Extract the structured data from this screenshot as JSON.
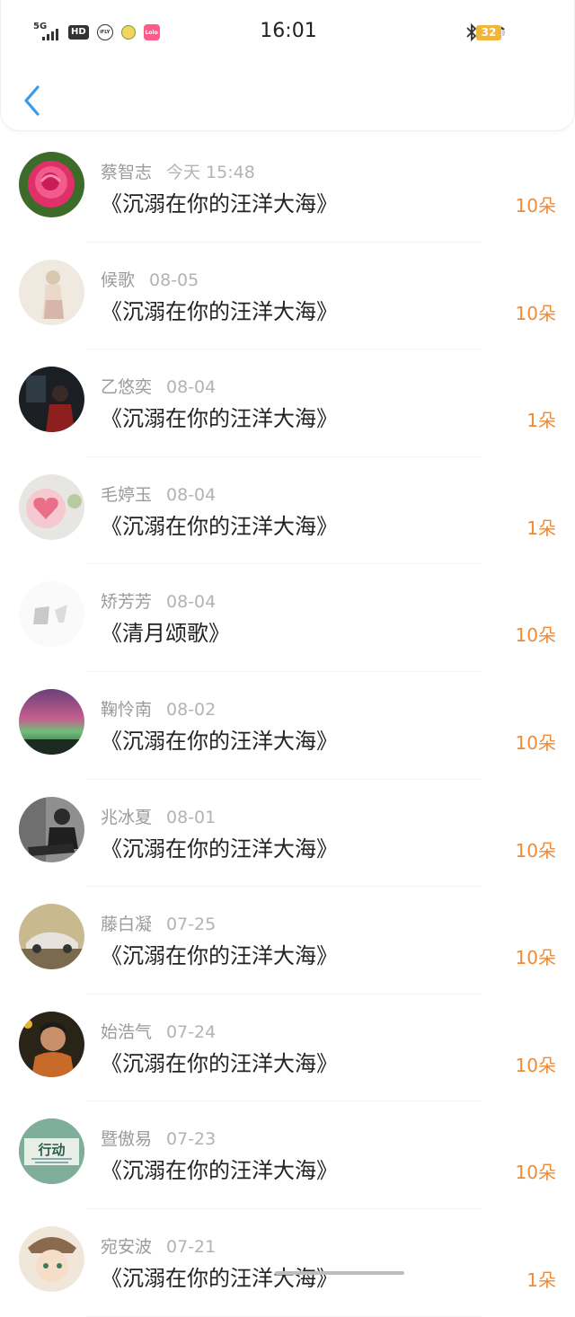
{
  "status_bar": {
    "network": "5G",
    "hd_label": "HD",
    "ifly_label": "iFLY",
    "app_label": "Lolo",
    "time": "16:01",
    "battery": "32"
  },
  "colors": {
    "accent_blue": "#3a9be8",
    "amount_orange": "#ef8a35"
  },
  "records": [
    {
      "name": "蔡智志",
      "time": "今天 15:48",
      "title": "《沉溺在你的汪洋大海》",
      "amount": "10朵"
    },
    {
      "name": "候歌",
      "time": "08-05",
      "title": "《沉溺在你的汪洋大海》",
      "amount": "10朵"
    },
    {
      "name": "乙悠奕",
      "time": "08-04",
      "title": "《沉溺在你的汪洋大海》",
      "amount": "1朵"
    },
    {
      "name": "毛婷玉",
      "time": "08-04",
      "title": "《沉溺在你的汪洋大海》",
      "amount": "1朵"
    },
    {
      "name": "矫芳芳",
      "time": "08-04",
      "title": "《清月颂歌》",
      "amount": "10朵"
    },
    {
      "name": "鞠怜南",
      "time": "08-02",
      "title": "《沉溺在你的汪洋大海》",
      "amount": "10朵"
    },
    {
      "name": "兆冰夏",
      "time": "08-01",
      "title": "《沉溺在你的汪洋大海》",
      "amount": "10朵"
    },
    {
      "name": "藤白凝",
      "time": "07-25",
      "title": "《沉溺在你的汪洋大海》",
      "amount": "10朵"
    },
    {
      "name": "始浩气",
      "time": "07-24",
      "title": "《沉溺在你的汪洋大海》",
      "amount": "10朵"
    },
    {
      "name": "暨傲易",
      "time": "07-23",
      "title": "《沉溺在你的汪洋大海》",
      "amount": "10朵"
    },
    {
      "name": "宛安波",
      "time": "07-21",
      "title": "《沉溺在你的汪洋大海》",
      "amount": "1朵"
    }
  ],
  "avatar_badges": {
    "r9_text": "行动"
  }
}
